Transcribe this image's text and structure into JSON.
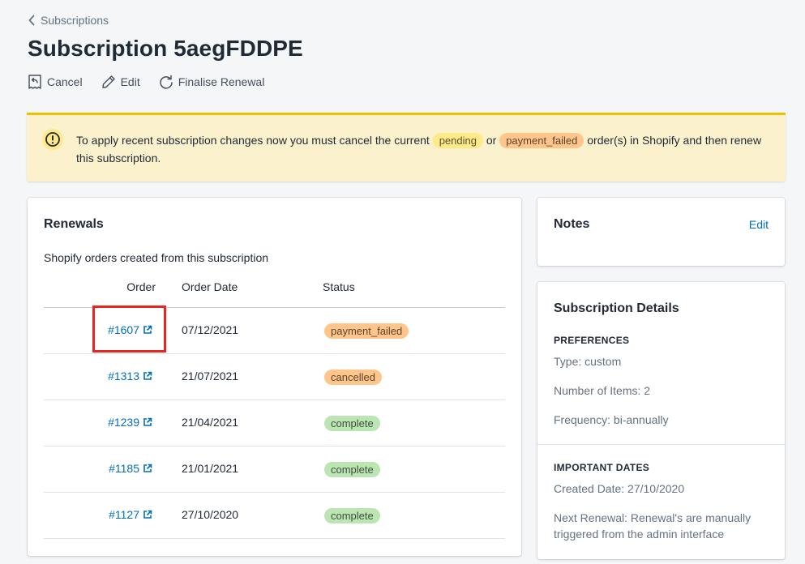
{
  "breadcrumb": {
    "label": "Subscriptions"
  },
  "page": {
    "title": "Subscription 5aegFDDPE"
  },
  "actions": {
    "cancel": "Cancel",
    "edit": "Edit",
    "finalise": "Finalise Renewal"
  },
  "banner": {
    "text_before": "To apply recent subscription changes now you must cancel the current",
    "pill_pending": "pending",
    "text_or": "or",
    "pill_failed": "payment_failed",
    "text_after": "order(s) in Shopify and then renew this subscription."
  },
  "renewals": {
    "title": "Renewals",
    "subtitle": "Shopify orders created from this subscription",
    "columns": {
      "order": "Order",
      "date": "Order Date",
      "status": "Status"
    },
    "rows": [
      {
        "order": "#1607",
        "date": "07/12/2021",
        "status": "payment_failed"
      },
      {
        "order": "#1313",
        "date": "21/07/2021",
        "status": "cancelled"
      },
      {
        "order": "#1239",
        "date": "21/04/2021",
        "status": "complete"
      },
      {
        "order": "#1185",
        "date": "21/01/2021",
        "status": "complete"
      },
      {
        "order": "#1127",
        "date": "27/10/2020",
        "status": "complete"
      }
    ]
  },
  "notes": {
    "title": "Notes",
    "edit": "Edit"
  },
  "details": {
    "title": "Subscription Details",
    "preferences_heading": "PREFERENCES",
    "type": "Type: custom",
    "items": "Number of Items: 2",
    "frequency": "Frequency: bi-annually",
    "dates_heading": "IMPORTANT DATES",
    "created": "Created Date: 27/10/2020",
    "next_renewal": "Next Renewal: Renewal's are manually triggered from the admin interface"
  },
  "colors": {
    "link": "#006fbb",
    "warning_bg": "#fcf1cd",
    "warning_border": "#eec200",
    "pill_pending": "#ffea8a",
    "pill_failed": "#ffc58b",
    "pill_complete": "#bbe5b3",
    "highlight": "#e8261f"
  }
}
